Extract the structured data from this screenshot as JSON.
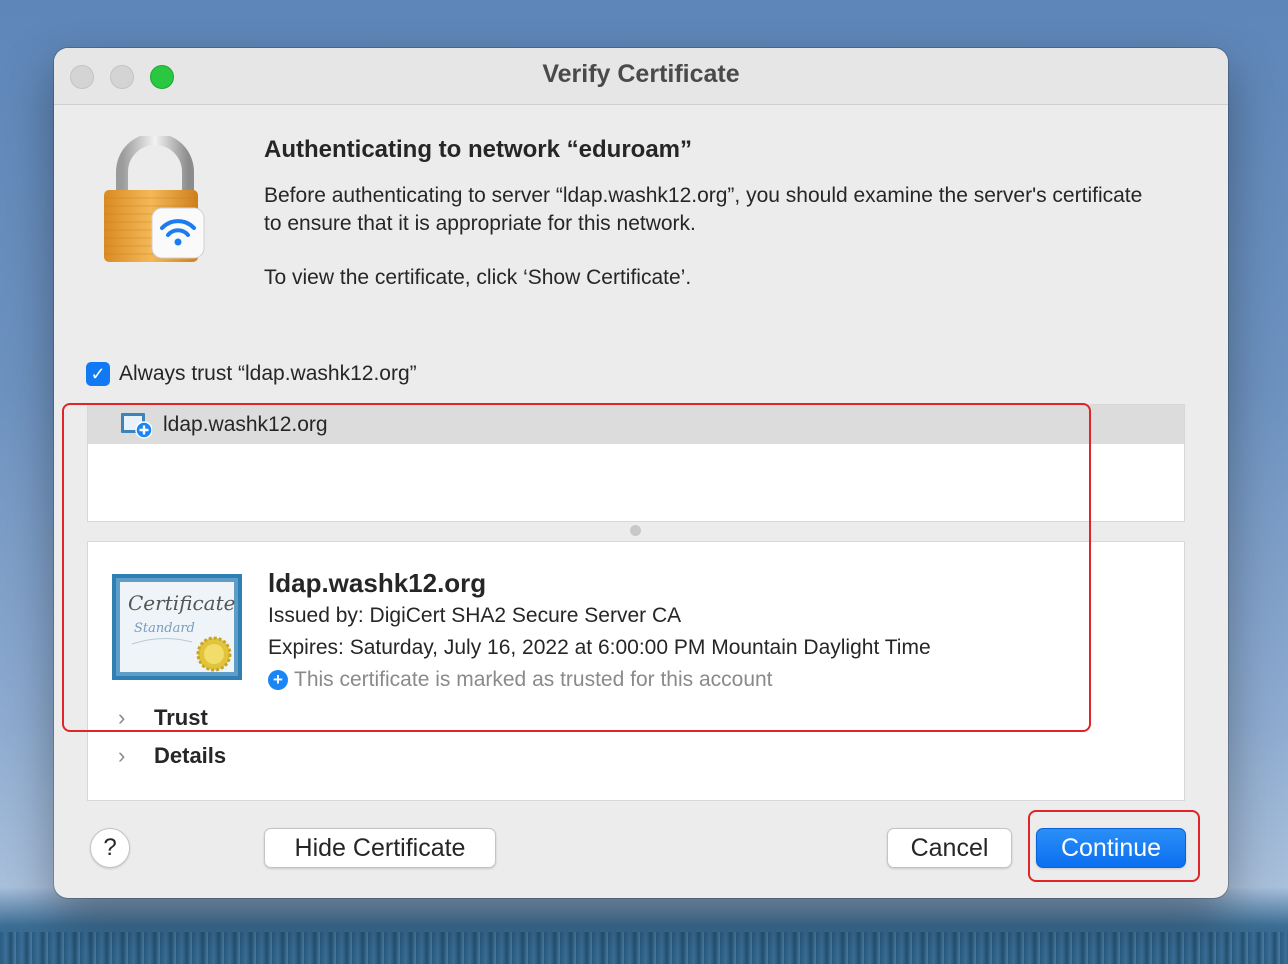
{
  "window": {
    "title": "Verify Certificate"
  },
  "header": {
    "heading": "Authenticating to network “eduroam”",
    "description": "Before authenticating to server “ldap.washk12.org”, you should examine the server's certificate to ensure that it is appropriate for this network.",
    "instruction": "To view the certificate, click ‘Show Certificate’."
  },
  "always_trust": {
    "checked": true,
    "label": "Always trust “ldap.washk12.org”"
  },
  "cert_list": {
    "items": [
      {
        "label": "ldap.washk12.org"
      }
    ]
  },
  "cert_details": {
    "name": "ldap.washk12.org",
    "issued_by": "Issued by: DigiCert SHA2 Secure Server CA",
    "expires": "Expires: Saturday, July 16, 2022 at 6:00:00 PM Mountain Daylight Time",
    "trusted_note": "This certificate is marked as trusted for this account",
    "sections": [
      {
        "label": "Trust"
      },
      {
        "label": "Details"
      }
    ]
  },
  "buttons": {
    "help": "?",
    "hide_certificate": "Hide Certificate",
    "cancel": "Cancel",
    "continue": "Continue"
  },
  "colors": {
    "accent": "#1279f5",
    "highlight_box": "#e0242a"
  }
}
